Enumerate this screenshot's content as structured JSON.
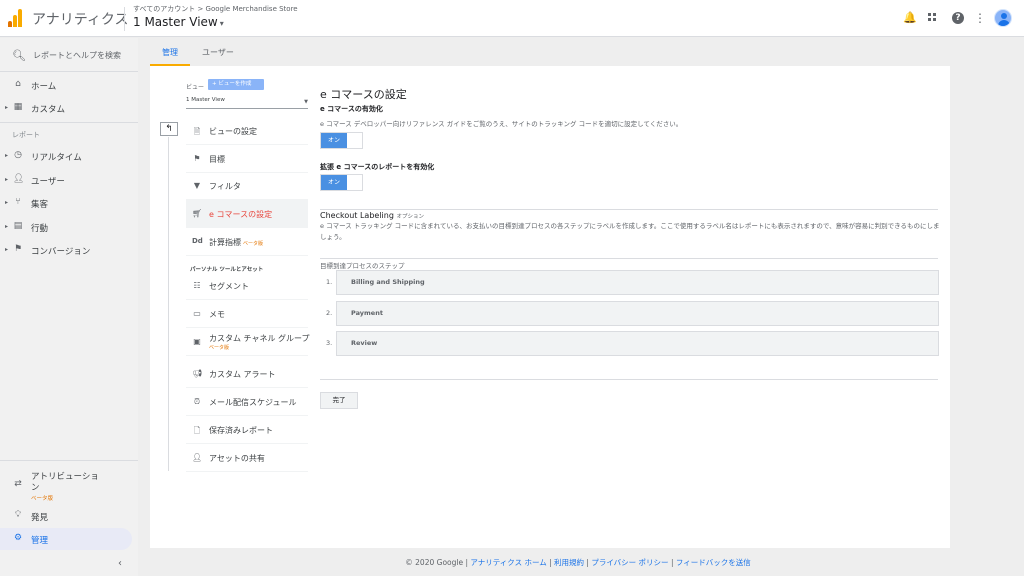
{
  "header": {
    "app_title": "アナリティクス",
    "breadcrumb": "すべてのアカウント > Google Merchandise Store",
    "view_name": "1 Master View",
    "icons": [
      "bell-icon",
      "apps-grid-icon",
      "help-icon",
      "more-vert-icon",
      "avatar"
    ]
  },
  "sidebar": {
    "search_label": "レポートとヘルプを検索",
    "items": [
      {
        "label": "ホーム",
        "icon": "home-icon"
      },
      {
        "label": "カスタム",
        "icon": "dashboard-icon"
      },
      {
        "label": "リアルタイム",
        "icon": "clock-icon"
      },
      {
        "label": "ユーザー",
        "icon": "person-icon"
      },
      {
        "label": "集客",
        "icon": "acquisition-icon"
      },
      {
        "label": "行動",
        "icon": "behavior-icon"
      },
      {
        "label": "コンバージョン",
        "icon": "flag-icon"
      }
    ],
    "section_report": "レポート",
    "bottom_items": [
      {
        "label": "アトリビューション",
        "beta": "ベータ版",
        "icon": "attribution-icon"
      },
      {
        "label": "発見",
        "icon": "lightbulb-icon"
      },
      {
        "label": "管理",
        "icon": "gear-icon"
      }
    ]
  },
  "tabs": [
    {
      "label": "管理"
    },
    {
      "label": "ユーザー"
    }
  ],
  "view_column": {
    "view_label": "ビュー",
    "create_button": "+ ビューを作成",
    "selected_view": "1 Master View",
    "items": [
      {
        "label": "ビューの設定",
        "icon": "doc-icon"
      },
      {
        "label": "目標",
        "icon": "flag-icon"
      },
      {
        "label": "フィルタ",
        "icon": "filter-icon"
      },
      {
        "label": "e コマースの設定",
        "icon": "cart-icon"
      },
      {
        "label": "計算指標",
        "beta": "ベータ版",
        "icon": "dd-icon"
      }
    ],
    "section_title": "パーソナル ツールとアセット",
    "personal_items": [
      {
        "label": "セグメント",
        "icon": "segment-icon"
      },
      {
        "label": "メモ",
        "icon": "note-icon"
      },
      {
        "label": "カスタム チャネル グループ",
        "beta": "ベータ版",
        "icon": "channel-icon"
      },
      {
        "label": "カスタム アラート",
        "icon": "megaphone-icon"
      },
      {
        "label": "メール配信スケジュール",
        "icon": "alarm-icon"
      },
      {
        "label": "保存済みレポート",
        "icon": "file-icon"
      },
      {
        "label": "アセットの共有",
        "icon": "person-add-icon"
      }
    ]
  },
  "content": {
    "title": "e コマースの設定",
    "enable_title": "e コマースの有効化",
    "enable_desc": "e コマース デベロッパー向けリファレンス ガイドをご覧のうえ、サイトのトラッキング コードを適切に設定してください。",
    "toggle_on": "オン",
    "enhanced_title": "拡張 e コマースのレポートを有効化",
    "checkout_title": "Checkout Labeling",
    "optional": "オプション",
    "checkout_desc": "e コマース トラッキング コードに含まれている、お支払いの目標到達プロセスの各ステップにラベルを作成します。ここで使用するラベル名はレポートにも表示されますので、意味が容易に判別できるものにしましょう。",
    "funnel_title": "目標到達プロセスのステップ",
    "steps": [
      {
        "num": "1.",
        "label": "Billing and Shipping"
      },
      {
        "num": "2.",
        "label": "Payment"
      },
      {
        "num": "3.",
        "label": "Review"
      }
    ],
    "done_button": "完了"
  },
  "footer": {
    "copyright": "© 2020 Google",
    "links": [
      "アナリティクス ホーム",
      "利用規約",
      "プライバシー ポリシー",
      "フィードバックを送信"
    ]
  }
}
